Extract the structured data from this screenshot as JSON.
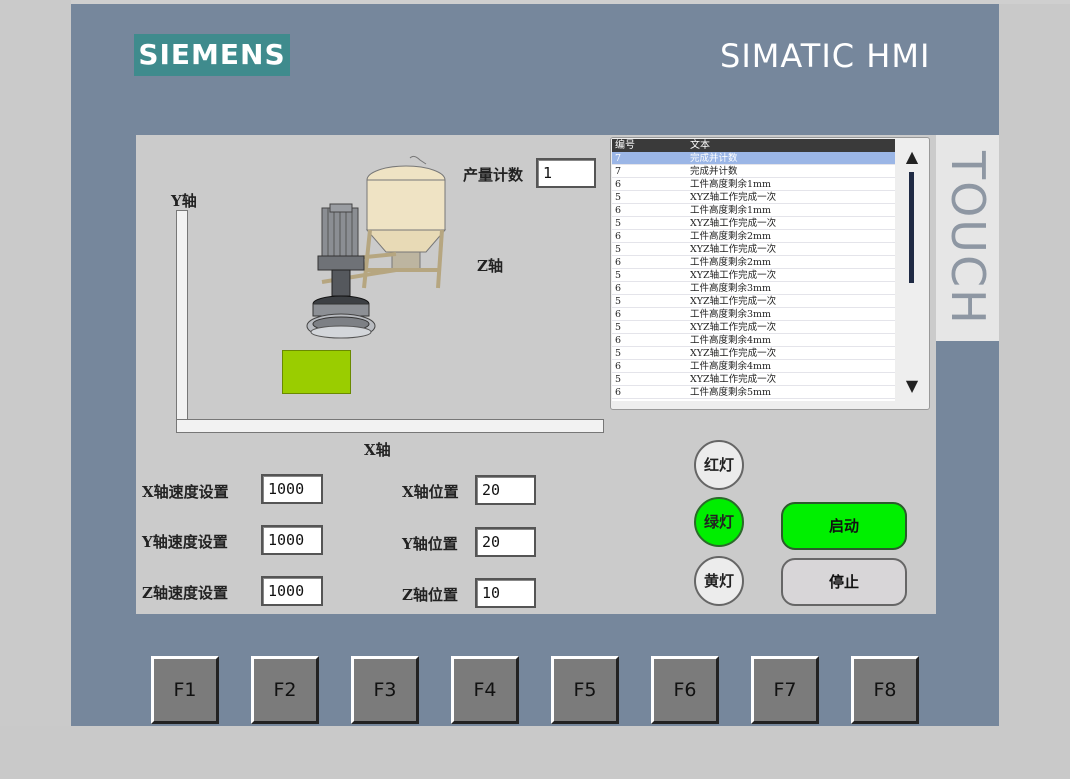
{
  "header": {
    "brand": "SIEMENS",
    "product": "SIMATIC HMI",
    "touch": "TOUCH"
  },
  "axes": {
    "y": "Y轴",
    "x": "X轴",
    "z": "Z轴"
  },
  "counter": {
    "label": "产量计数",
    "value": "1"
  },
  "speed": {
    "x_label": "X轴速度设置",
    "x_value": "1000",
    "y_label": "Y轴速度设置",
    "y_value": "1000",
    "z_label": "Z轴速度设置",
    "z_value": "1000"
  },
  "position": {
    "x_label": "X轴位置",
    "x_value": "20",
    "y_label": "Y轴位置",
    "y_value": "20",
    "z_label": "Z轴位置",
    "z_value": "10"
  },
  "alarm": {
    "col_id": "编号",
    "col_text": "文本",
    "rows": [
      {
        "id": "7",
        "text": "完成并计数"
      },
      {
        "id": "7",
        "text": "完成并计数"
      },
      {
        "id": "6",
        "text": "工件高度剩余1mm"
      },
      {
        "id": "5",
        "text": "XYZ轴工作完成一次"
      },
      {
        "id": "6",
        "text": "工件高度剩余1mm"
      },
      {
        "id": "5",
        "text": "XYZ轴工作完成一次"
      },
      {
        "id": "6",
        "text": "工件高度剩余2mm"
      },
      {
        "id": "5",
        "text": "XYZ轴工作完成一次"
      },
      {
        "id": "6",
        "text": "工件高度剩余2mm"
      },
      {
        "id": "5",
        "text": "XYZ轴工作完成一次"
      },
      {
        "id": "6",
        "text": "工件高度剩余3mm"
      },
      {
        "id": "5",
        "text": "XYZ轴工作完成一次"
      },
      {
        "id": "6",
        "text": "工件高度剩余3mm"
      },
      {
        "id": "5",
        "text": "XYZ轴工作完成一次"
      },
      {
        "id": "6",
        "text": "工件高度剩余4mm"
      },
      {
        "id": "5",
        "text": "XYZ轴工作完成一次"
      },
      {
        "id": "6",
        "text": "工件高度剩余4mm"
      },
      {
        "id": "5",
        "text": "XYZ轴工作完成一次"
      },
      {
        "id": "6",
        "text": "工件高度剩余5mm"
      }
    ]
  },
  "lamps": {
    "red": "红灯",
    "green": "绿灯",
    "yellow": "黄灯"
  },
  "buttons": {
    "start": "启动",
    "stop": "停止"
  },
  "fkeys": [
    "F1",
    "F2",
    "F3",
    "F4",
    "F5",
    "F6",
    "F7",
    "F8"
  ],
  "colors": {
    "bezel": "#76879c",
    "screen": "#cbcbcb",
    "brand": "#3f8b8d",
    "green_on": "#00ee00",
    "workpiece": "#9acd00"
  },
  "scroll_up_icon": "▲",
  "scroll_down_icon": "▼"
}
